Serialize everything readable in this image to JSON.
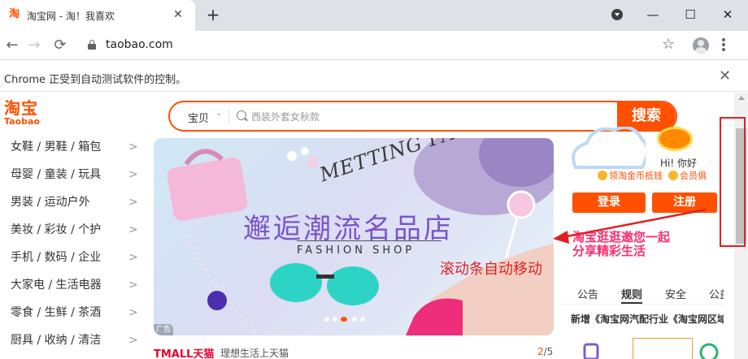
{
  "browser": {
    "tab_title": "淘宝网 - 淘！我喜欢",
    "favicon_glyph": "淘",
    "close_glyph": "✕",
    "newtab_glyph": "+",
    "url": "taobao.com",
    "back_glyph": "←",
    "forward_glyph": "→",
    "reload_glyph": "⟳",
    "star_glyph": "☆",
    "minimize_glyph": "—",
    "maximize_glyph": "☐",
    "window_close_glyph": "✕",
    "infobar_text": "Chrome 正受到自动测试软件的控制。",
    "infobar_close_glyph": "✕"
  },
  "logo": {
    "cn": "淘宝",
    "en": "Taobao"
  },
  "search": {
    "category": "宝贝",
    "category_arrow": "⌄",
    "placeholder": "西装外套女秋款",
    "button": "搜索"
  },
  "categories": [
    "女鞋 / 男鞋 / 箱包",
    "母婴 / 童装 / 玩具",
    "男装 / 运动户外",
    "美妆 / 彩妆 / 个护",
    "手机 / 数码 / 企业",
    "大家电 / 生活电器",
    "零食 / 生鲜 / 茶酒",
    "厨具 / 收纳 / 清洁"
  ],
  "category_arrow": ">",
  "banner": {
    "slogan_line": "METTING FASHION",
    "title": "邂逅潮流名品店",
    "subtitle": "FASHION SHOP",
    "ad_label": "广告"
  },
  "tmall": {
    "logo": "TMALL天猫",
    "text": "理想生活上天猫",
    "page_current": "2",
    "page_total": "/5"
  },
  "annotation": "滚动条自动移动",
  "user_panel": {
    "greeting": "Hi! 你好",
    "coin_text": "领淘金币抵钱",
    "member_text": "会员俱",
    "login": "登录",
    "register": "注册",
    "promo_line1": "淘宝逛逛邀您一起",
    "promo_line2": "分享精彩生活",
    "tabs": [
      "公告",
      "规则",
      "安全",
      "公益"
    ],
    "active_tab": "规则",
    "news": "新增《淘宝网汽配行业《淘宝网区域"
  },
  "colors": {
    "brand": "#ff5000",
    "annotation": "#e02020",
    "banner_title": "#7a55c9"
  }
}
